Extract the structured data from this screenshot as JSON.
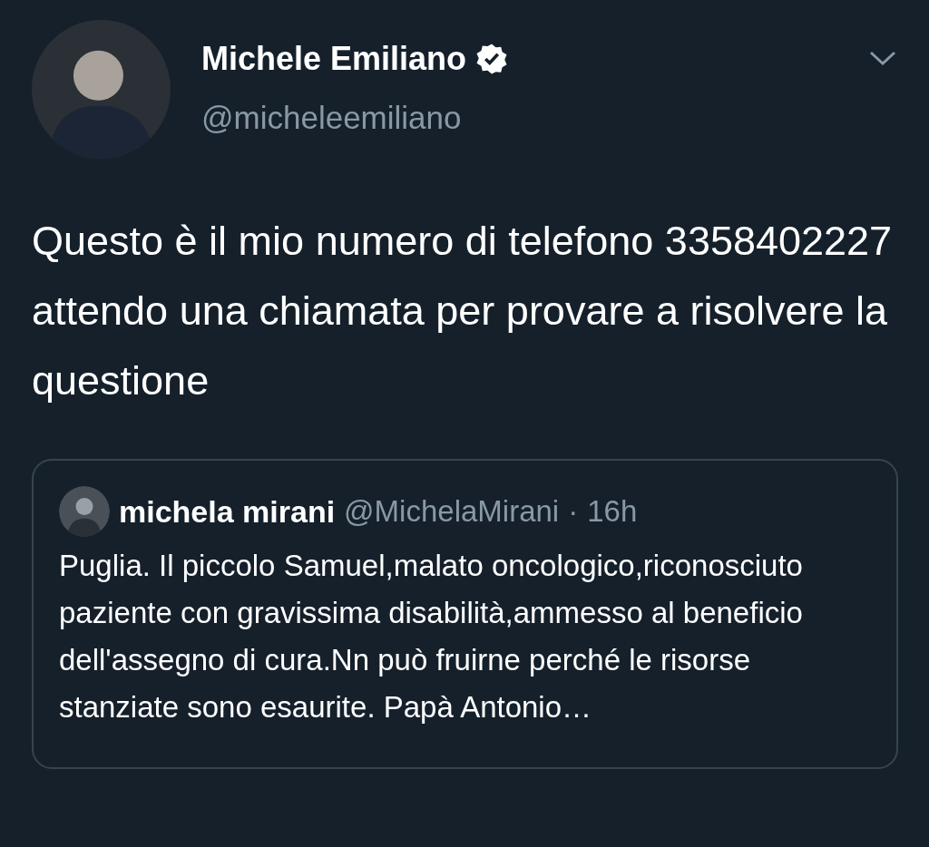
{
  "author": {
    "name": "Michele Emiliano",
    "verified": true,
    "handle": "@micheleemiliano"
  },
  "tweet": {
    "text": "Questo è il mio numero di telefono 3358402227 attendo una chiamata per provare a risolvere la questione"
  },
  "quote": {
    "name": "michela mirani",
    "handle": "@MichelaMirani",
    "separator": "·",
    "time": "16h",
    "text": "Puglia. Il piccolo Samuel,malato oncologico,riconosciuto paziente con gravissima disabilità,ammesso al beneficio dell'assegno di cura.Nn può fruirne perché le risorse stanziate sono esaurite. Papà Antonio…"
  }
}
